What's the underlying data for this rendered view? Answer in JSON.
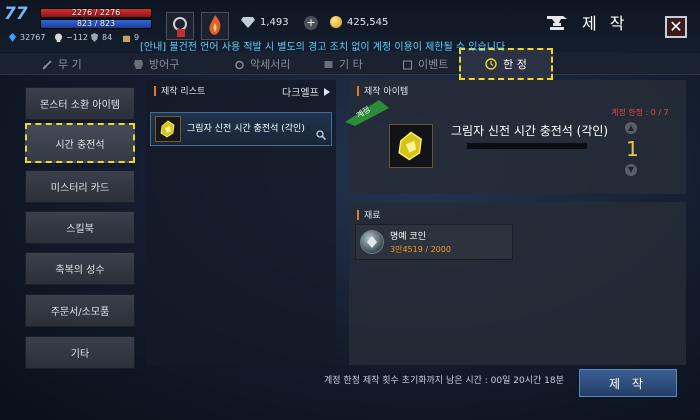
{
  "player": {
    "level": "77",
    "hp": "2276 / 2276",
    "mp": "823 / 823",
    "stats": [
      "32767",
      "−112",
      "84",
      "9"
    ]
  },
  "currency": {
    "gems": "1,493",
    "gold": "425,545"
  },
  "window": {
    "title": "제 작",
    "close": "✕"
  },
  "notice": "[안내] 불건전 언어 사용 적발 시 별도의 경고 조치 없이 계정 이용이 제한될 수 있습니다",
  "tabs": [
    {
      "label": "무 기"
    },
    {
      "label": "방어구"
    },
    {
      "label": "악세서리"
    },
    {
      "label": "기 타"
    },
    {
      "label": "이벤트"
    },
    {
      "label": "한 정"
    }
  ],
  "categories": [
    {
      "label": "몬스터 소환 아이템"
    },
    {
      "label": "시간 충전석"
    },
    {
      "label": "미스터리 카드"
    },
    {
      "label": "스킬북"
    },
    {
      "label": "축복의 성수"
    },
    {
      "label": "주문서/소모품"
    },
    {
      "label": "기타"
    }
  ],
  "craft_list": {
    "header": "제작 리스트",
    "filter": "다크엘프",
    "items": [
      {
        "name": "그림자 신전 시간 충전석 (각인)"
      }
    ]
  },
  "craft_item": {
    "header": "제작 아이템",
    "ribbon": "계정",
    "name": "그림자 신전 시간 충전석 (각인)",
    "limit": "계정 한정 : 0 / 7",
    "quantity": "1"
  },
  "materials": {
    "header": "재료",
    "items": [
      {
        "name": "명예 코인",
        "amount": "3만4519 / 2000"
      }
    ]
  },
  "footer": {
    "reset_text": "계정 한정 제작 횟수 초기화까지 남은 시간 : 00일 20시간 18분",
    "craft_button": "제 작"
  },
  "colors": {
    "highlight_dashed": "#f2d72a",
    "limit_red": "#e04848",
    "quantity_gold": "#f1c24a",
    "amount_orange": "#f0a020",
    "ribbon_green": "#2f8a3a",
    "selected_blue": "#3c6d9d"
  }
}
